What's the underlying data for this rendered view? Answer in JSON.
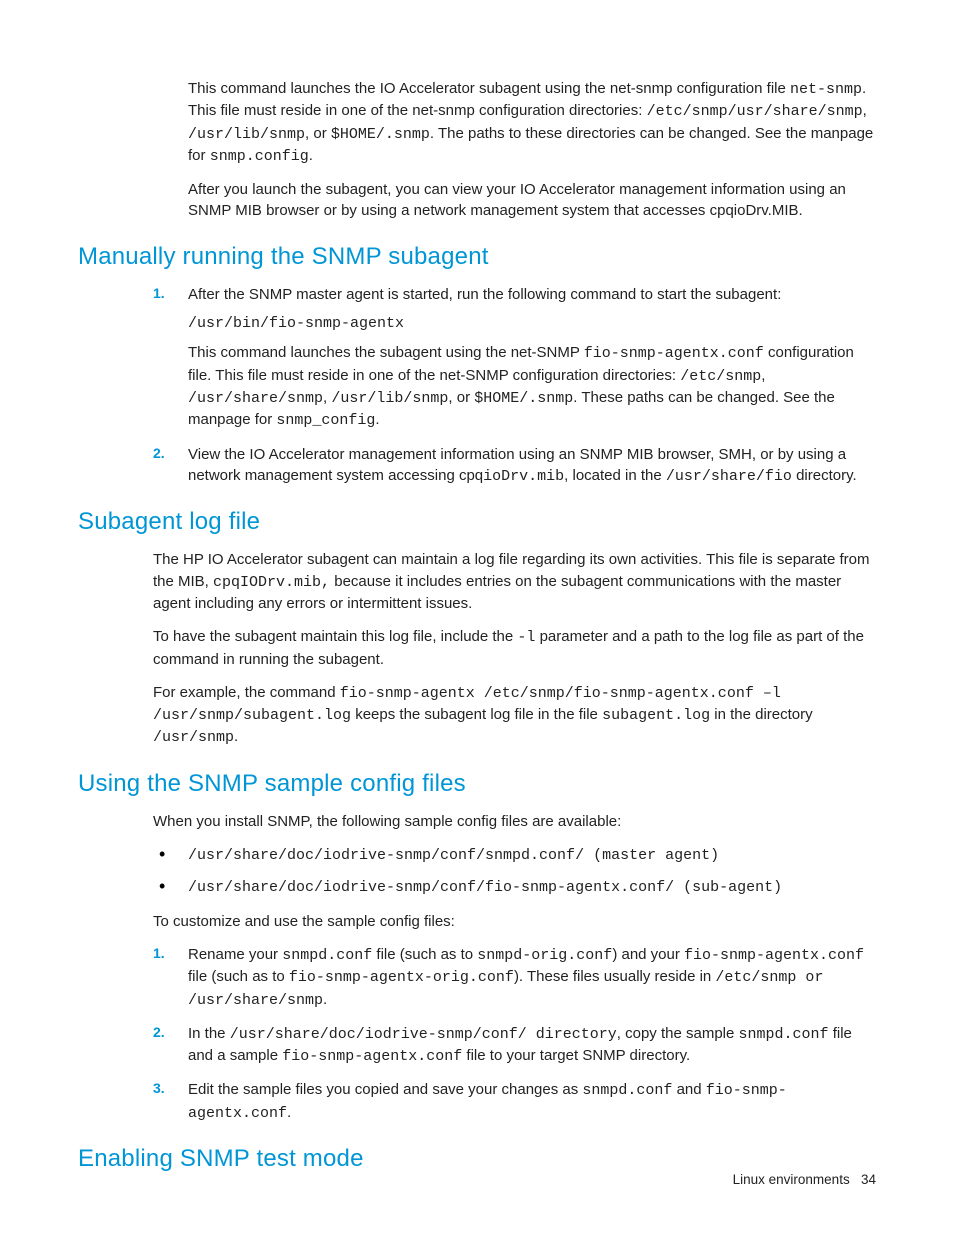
{
  "intro": {
    "p1a": "This command launches the IO Accelerator subagent using the net-snmp configuration file ",
    "p1b": "net-snmp",
    "p1c": ". This file must reside in one of the net-snmp configuration directories: ",
    "p1d": "/etc/snmp/usr/share/snmp",
    "p1e": ", ",
    "p1f": "/usr/lib/snmp",
    "p1g": ", or ",
    "p1h": "$HOME/.snmp",
    "p1i": ". The paths to these directories can be changed. See the manpage for ",
    "p1j": "snmp.config",
    "p1k": ".",
    "p2": "After you launch the subagent, you can view your IO Accelerator management information using an SNMP MIB browser or by using a network management system that accesses cpqioDrv.MIB."
  },
  "s1": {
    "heading": "Manually running the SNMP subagent",
    "li1": {
      "num": "1.",
      "p1": "After the SNMP master agent is started, run the following command to start the subagent:",
      "cmd": "/usr/bin/fio-snmp-agentx",
      "p2a": "This command launches the subagent using the net-SNMP ",
      "p2b": "fio-snmp-agentx.conf",
      "p2c": " configuration file. This file must reside in one of the net-SNMP configuration directories: ",
      "p2d": "/etc/snmp",
      "p2e": ", ",
      "p2f": "/usr/share/snmp",
      "p2g": ", ",
      "p2h": "/usr/lib/snmp",
      "p2i": ", or ",
      "p2j": "$HOME/.snmp",
      "p2k": ". These paths can be changed. See the manpage for ",
      "p2l": "snmp_config",
      "p2m": "."
    },
    "li2": {
      "num": "2.",
      "p1a": "View the IO Accelerator management information using an SNMP MIB browser, SMH, or by using a network management system accessing cpq",
      "p1b": "ioDrv.mib",
      "p1c": ", located  in the ",
      "p1d": "/usr/share/fio",
      "p1e": " directory."
    }
  },
  "s2": {
    "heading": "Subagent log file",
    "p1a": "The HP IO Accelerator subagent can maintain a log file regarding its own activities. This file is separate from the MIB, ",
    "p1b": "cpqIODrv.mib,",
    "p1c": " because it includes entries on the subagent communications with the master agent including any errors or intermittent issues.",
    "p2a": "To have the subagent maintain this log file, include the ",
    "p2b": "-l",
    "p2c": " parameter and a path to the log file as part of the command in running the subagent.",
    "p3a": "For example, the command ",
    "p3b": "fio-snmp-agentx /etc/snmp/fio-snmp-agentx.conf –l /usr/snmp/subagent.log",
    "p3c": " keeps the subagent log file in the file ",
    "p3d": "subagent.log",
    "p3e": " in the directory ",
    "p3f": "/usr/snmp",
    "p3g": "."
  },
  "s3": {
    "heading": "Using the SNMP sample config files",
    "p1": "When you install SNMP, the following sample config files are available:",
    "b1": "/usr/share/doc/iodrive-snmp/conf/snmpd.conf/ (master agent)",
    "b2": "/usr/share/doc/iodrive-snmp/conf/fio-snmp-agentx.conf/ (sub-agent)",
    "p2": "To customize and use the sample config files:",
    "li1": {
      "num": "1.",
      "a": "Rename your ",
      "b": "snmpd.conf",
      "c": " file (such as to ",
      "d": "snmpd-orig.conf",
      "e": ") and your ",
      "f": "fio-snmp-agentx.conf",
      "g": " file (such as to ",
      "h": "fio-snmp-agentx-orig.conf",
      "i": "). These files usually reside in ",
      "j": "/etc/snmp or /usr/share/snmp",
      "k": "."
    },
    "li2": {
      "num": "2.",
      "a": "In the ",
      "b": "/usr/share/doc/iodrive-snmp/conf/ directory",
      "c": ", copy the sample ",
      "d": "snmpd.conf",
      "e": " file and a sample ",
      "f": "fio-snmp-agentx.conf",
      "g": " file to your target SNMP directory."
    },
    "li3": {
      "num": "3.",
      "a": "Edit the sample files you copied and save your changes as ",
      "b": "snmpd.conf",
      "c": " and ",
      "d": "fio-snmp-agentx.conf",
      "e": "."
    }
  },
  "s4": {
    "heading": "Enabling SNMP test mode"
  },
  "footer": {
    "label": "Linux environments",
    "page": "34"
  }
}
